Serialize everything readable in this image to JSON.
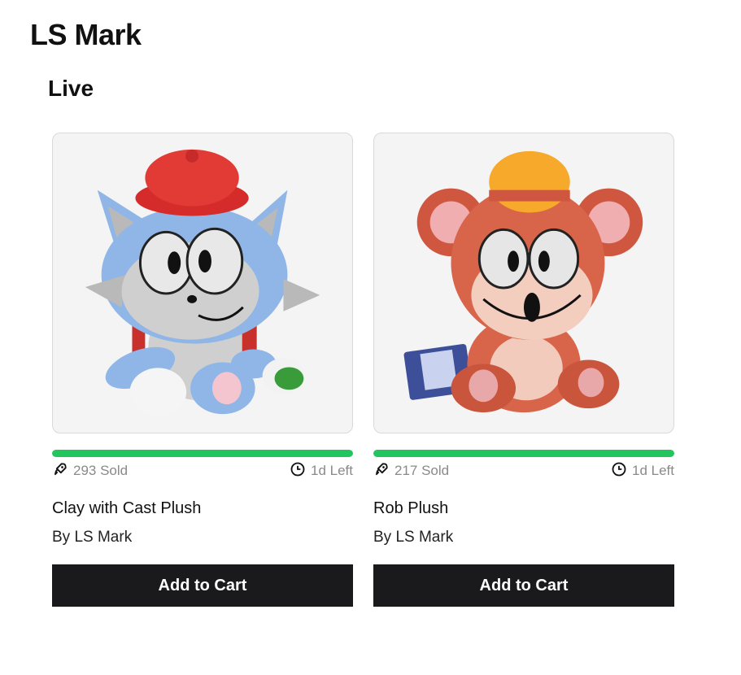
{
  "store": {
    "title": "LS Mark"
  },
  "section": {
    "title": "Live"
  },
  "accent_color": "#22c55e",
  "products": [
    {
      "name": "Clay with Cast Plush",
      "by": "By LS Mark",
      "sold": "293 Sold",
      "time_left": "1d Left",
      "progress": 1.0,
      "cart_label": "Add to Cart",
      "image_icon": "blue-cat-plush-image"
    },
    {
      "name": "Rob Plush",
      "by": "By LS Mark",
      "sold": "217 Sold",
      "time_left": "1d Left",
      "progress": 1.0,
      "cart_label": "Add to Cart",
      "image_icon": "orange-bear-plush-image"
    }
  ]
}
